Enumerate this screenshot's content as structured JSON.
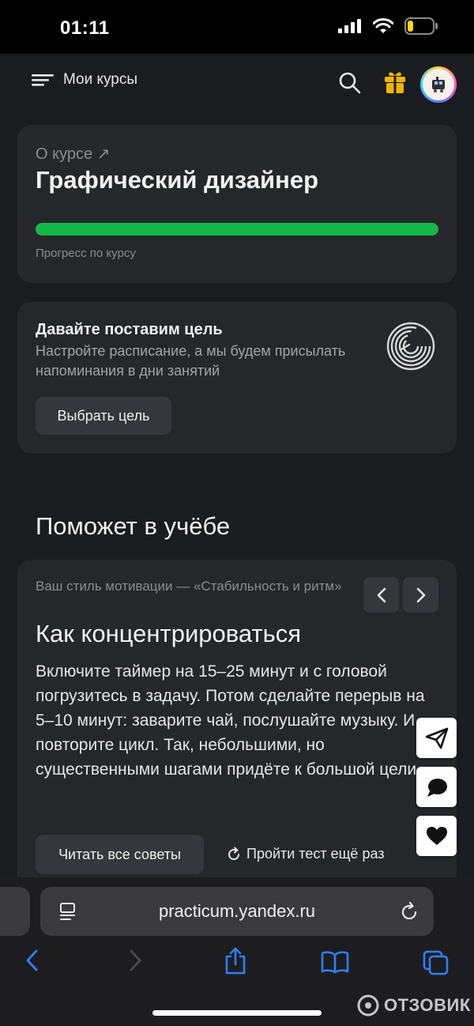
{
  "status_bar": {
    "time": "01:11"
  },
  "header": {
    "menu_label": "Мои курсы"
  },
  "course_card": {
    "about_link": "О курсе ↗",
    "title": "Графический дизайнер",
    "progress_fraction": 1.0,
    "progress_label": "Прогресс по курсу"
  },
  "goal_card": {
    "title": "Давайте поставим цель",
    "description": "Настройте расписание, а мы будем присылать напоминания в дни занятий",
    "button_label": "Выбрать цель"
  },
  "help_section": {
    "title": "Поможет в учёбе"
  },
  "tip_card": {
    "motivation_style": "Ваш стиль мотивации — «Стабильность и ритм»",
    "title": "Как концентрироваться",
    "body": "Включите таймер на 15–25 минут и с головой погрузитесь в задачу. Потом сделайте перерыв на 5–10 минут: заварите чай, послушайте музыку. И повторите цикл. Так, небольшими, но существенными шагами придёте к большой цели.",
    "read_all_label": "Читать все советы",
    "retest_label": "Пройти тест ещё раз"
  },
  "floating_actions": [
    "send-icon",
    "chat-icon",
    "heart-icon"
  ],
  "browser": {
    "url": "practicum.yandex.ru"
  },
  "watermark": {
    "text": "ОТЗОВИК"
  },
  "colors": {
    "progress": "#14b949",
    "app_bg": "#1b1c1f",
    "card_bg": "#26272b",
    "gift": "#f0b400",
    "browser_accent": "#2f7ff5"
  }
}
